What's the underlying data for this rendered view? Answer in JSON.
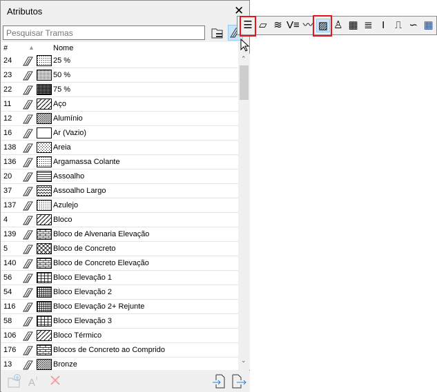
{
  "window": {
    "title": "Atributos"
  },
  "search": {
    "placeholder": "Pesquisar Tramas"
  },
  "header": {
    "col_id": "#",
    "col_name": "Nome"
  },
  "rows": [
    {
      "id": "24",
      "name": "25 %",
      "pattern": "dots1"
    },
    {
      "id": "23",
      "name": "50 %",
      "pattern": "dots2"
    },
    {
      "id": "22",
      "name": "75 %",
      "pattern": "dots3"
    },
    {
      "id": "11",
      "name": "Aço",
      "pattern": "diag"
    },
    {
      "id": "12",
      "name": "Alumínio",
      "pattern": "diag2"
    },
    {
      "id": "16",
      "name": "Ar (Vazio)",
      "pattern": "none"
    },
    {
      "id": "138",
      "name": "Areia",
      "pattern": "sand"
    },
    {
      "id": "136",
      "name": "Argamassa Colante",
      "pattern": "dots1"
    },
    {
      "id": "20",
      "name": "Assoalho",
      "pattern": "hlines"
    },
    {
      "id": "37",
      "name": "Assoalho Largo",
      "pattern": "zigzag"
    },
    {
      "id": "137",
      "name": "Azulejo",
      "pattern": "dots1"
    },
    {
      "id": "4",
      "name": "Bloco",
      "pattern": "diag"
    },
    {
      "id": "139",
      "name": "Bloco de Alvenaria Elevação",
      "pattern": "brick"
    },
    {
      "id": "5",
      "name": "Bloco de Concreto",
      "pattern": "cross"
    },
    {
      "id": "140",
      "name": "Bloco de Concreto Elevação",
      "pattern": "brick"
    },
    {
      "id": "56",
      "name": "Bloco Elevação 1",
      "pattern": "grid"
    },
    {
      "id": "54",
      "name": "Bloco Elevação 2",
      "pattern": "grid2"
    },
    {
      "id": "116",
      "name": "Bloco Elevação 2+ Rejunte",
      "pattern": "grid2"
    },
    {
      "id": "58",
      "name": "Bloco Elevação 3",
      "pattern": "grid"
    },
    {
      "id": "106",
      "name": "Bloco Térmico",
      "pattern": "diag"
    },
    {
      "id": "176",
      "name": "Blocos de Concreto ao Comprido",
      "pattern": "brick"
    },
    {
      "id": "13",
      "name": "Bronze",
      "pattern": "diag2"
    }
  ],
  "toolbar_icons": [
    "list-icon",
    "line-type-icon",
    "building-material-icon",
    "pen-set-icon",
    "surface-icon",
    "fill-icon",
    "profile-icon",
    "composite-icon",
    "zone-icon",
    "layer-icon",
    "markup-icon",
    "operation-profile-icon",
    "table-icon"
  ],
  "colors": {
    "highlight": "#e8141c",
    "selected": "#cce4f7",
    "accent": "#2a7fd4"
  }
}
